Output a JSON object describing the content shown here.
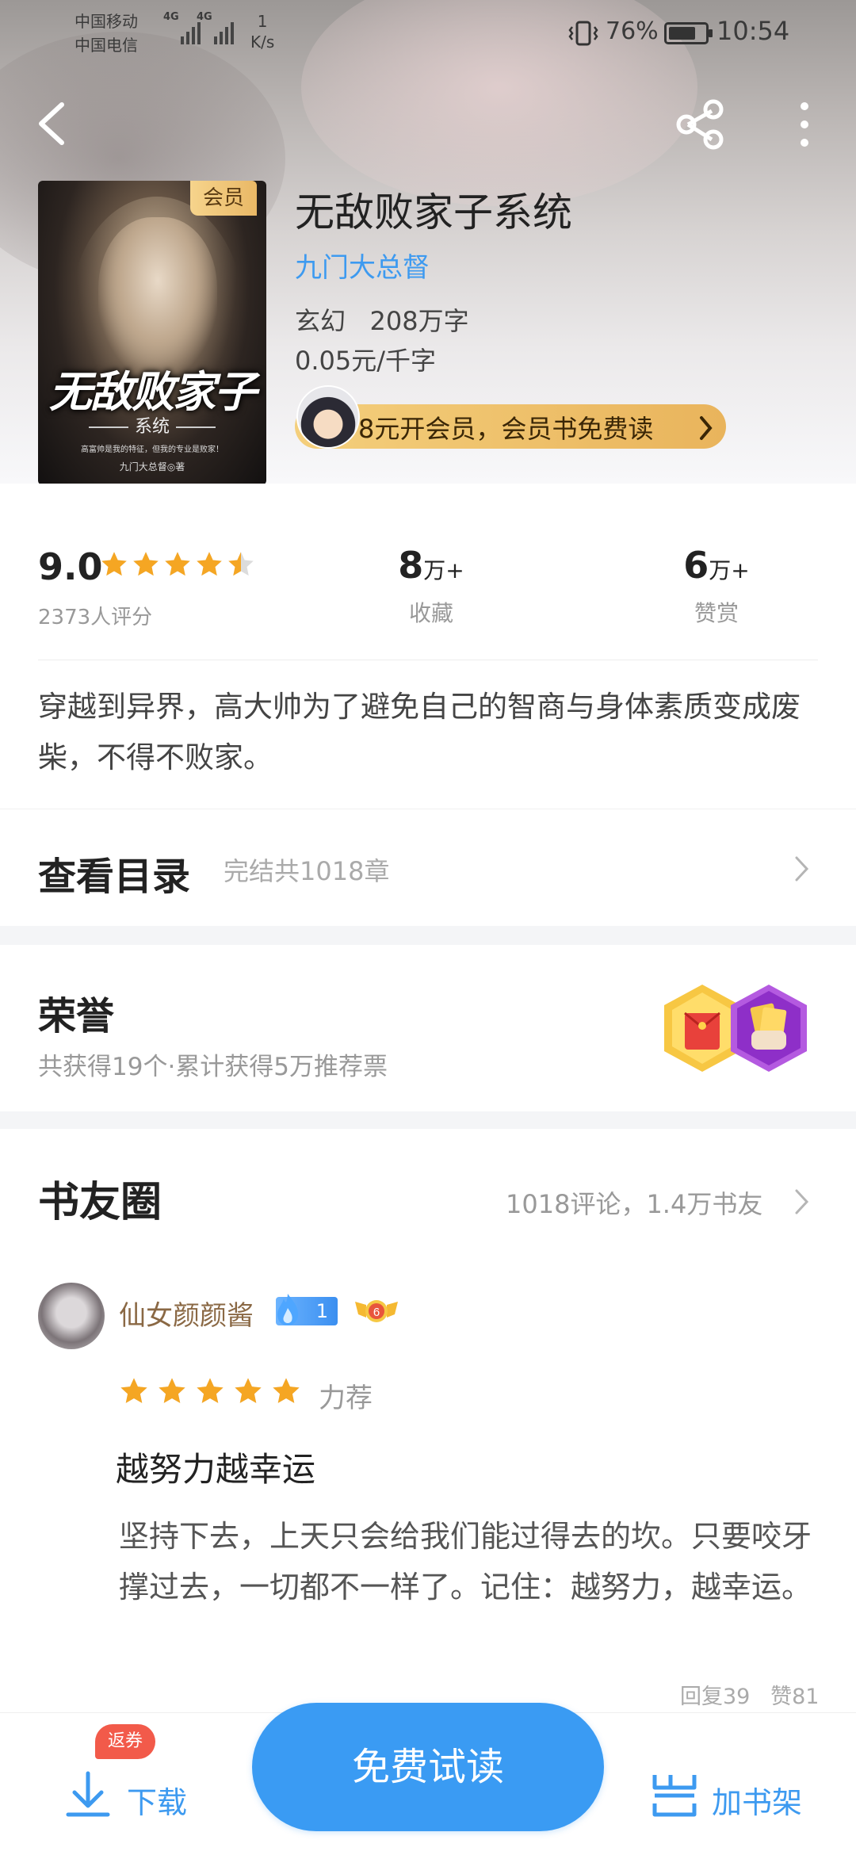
{
  "status": {
    "carrier1": "中国移动",
    "carrier2": "中国电信",
    "net1": "4G",
    "net2": "4G",
    "speed_value": "1",
    "speed_unit": "K/s",
    "battery": "76%",
    "battery_level": 0.76,
    "time": "10:54"
  },
  "book": {
    "title": "无敌败家子系统",
    "author": "九门大总督",
    "genre": "玄幻",
    "words": "208万字",
    "price": "0.05元/千字",
    "vip_badge": "会员",
    "cover_title": "无敌败家子",
    "cover_subtitle": "系统",
    "cover_tagline": "高富帅是我的特征，但我的专业是败家！",
    "cover_author": "九门大总督◎著"
  },
  "promo": {
    "text": "8元开会员，会员书免费读"
  },
  "stats": {
    "rating": "9.0",
    "rating_stars": 4.5,
    "rating_count": "2373人评分",
    "favorites_num": "8",
    "favorites_unit": "万+",
    "favorites_label": "收藏",
    "rewards_num": "6",
    "rewards_unit": "万+",
    "rewards_label": "赞赏"
  },
  "synopsis": "穿越到异界，高大帅为了避免自己的智商与身体素质变成废柴，不得不败家。",
  "toc": {
    "label": "查看目录",
    "sub": "完结共1018章"
  },
  "honor": {
    "title": "荣誉",
    "sub": "共获得19个·累计获得5万推荐票"
  },
  "circle": {
    "title": "书友圈",
    "meta": "1018评论，1.4万书友",
    "comment": {
      "user": "仙女颜颜酱",
      "fan_level": "1",
      "member_level": "6",
      "stars": 5,
      "recommend": "力荐",
      "headline": "越努力越幸运",
      "body": "坚持下去，上天只会给我们能过得去的坎。只要咬牙撑过去，一切都不一样了。记住：越努力，越幸运。",
      "replies": "回复39",
      "likes": "赞81"
    }
  },
  "bottom": {
    "download": "下载",
    "coupon": "返券",
    "read": "免费试读",
    "shelf": "加书架"
  },
  "colors": {
    "accent": "#3a9bf3",
    "gold": "#f5a623",
    "promo": "#f0c56e"
  },
  "icons": [
    "back-arrow-icon",
    "share-icon",
    "more-vertical-icon",
    "star-icon",
    "chevron-right-icon",
    "download-icon",
    "bookshelf-icon",
    "vibrate-icon",
    "flame-icon",
    "medal-icon"
  ]
}
